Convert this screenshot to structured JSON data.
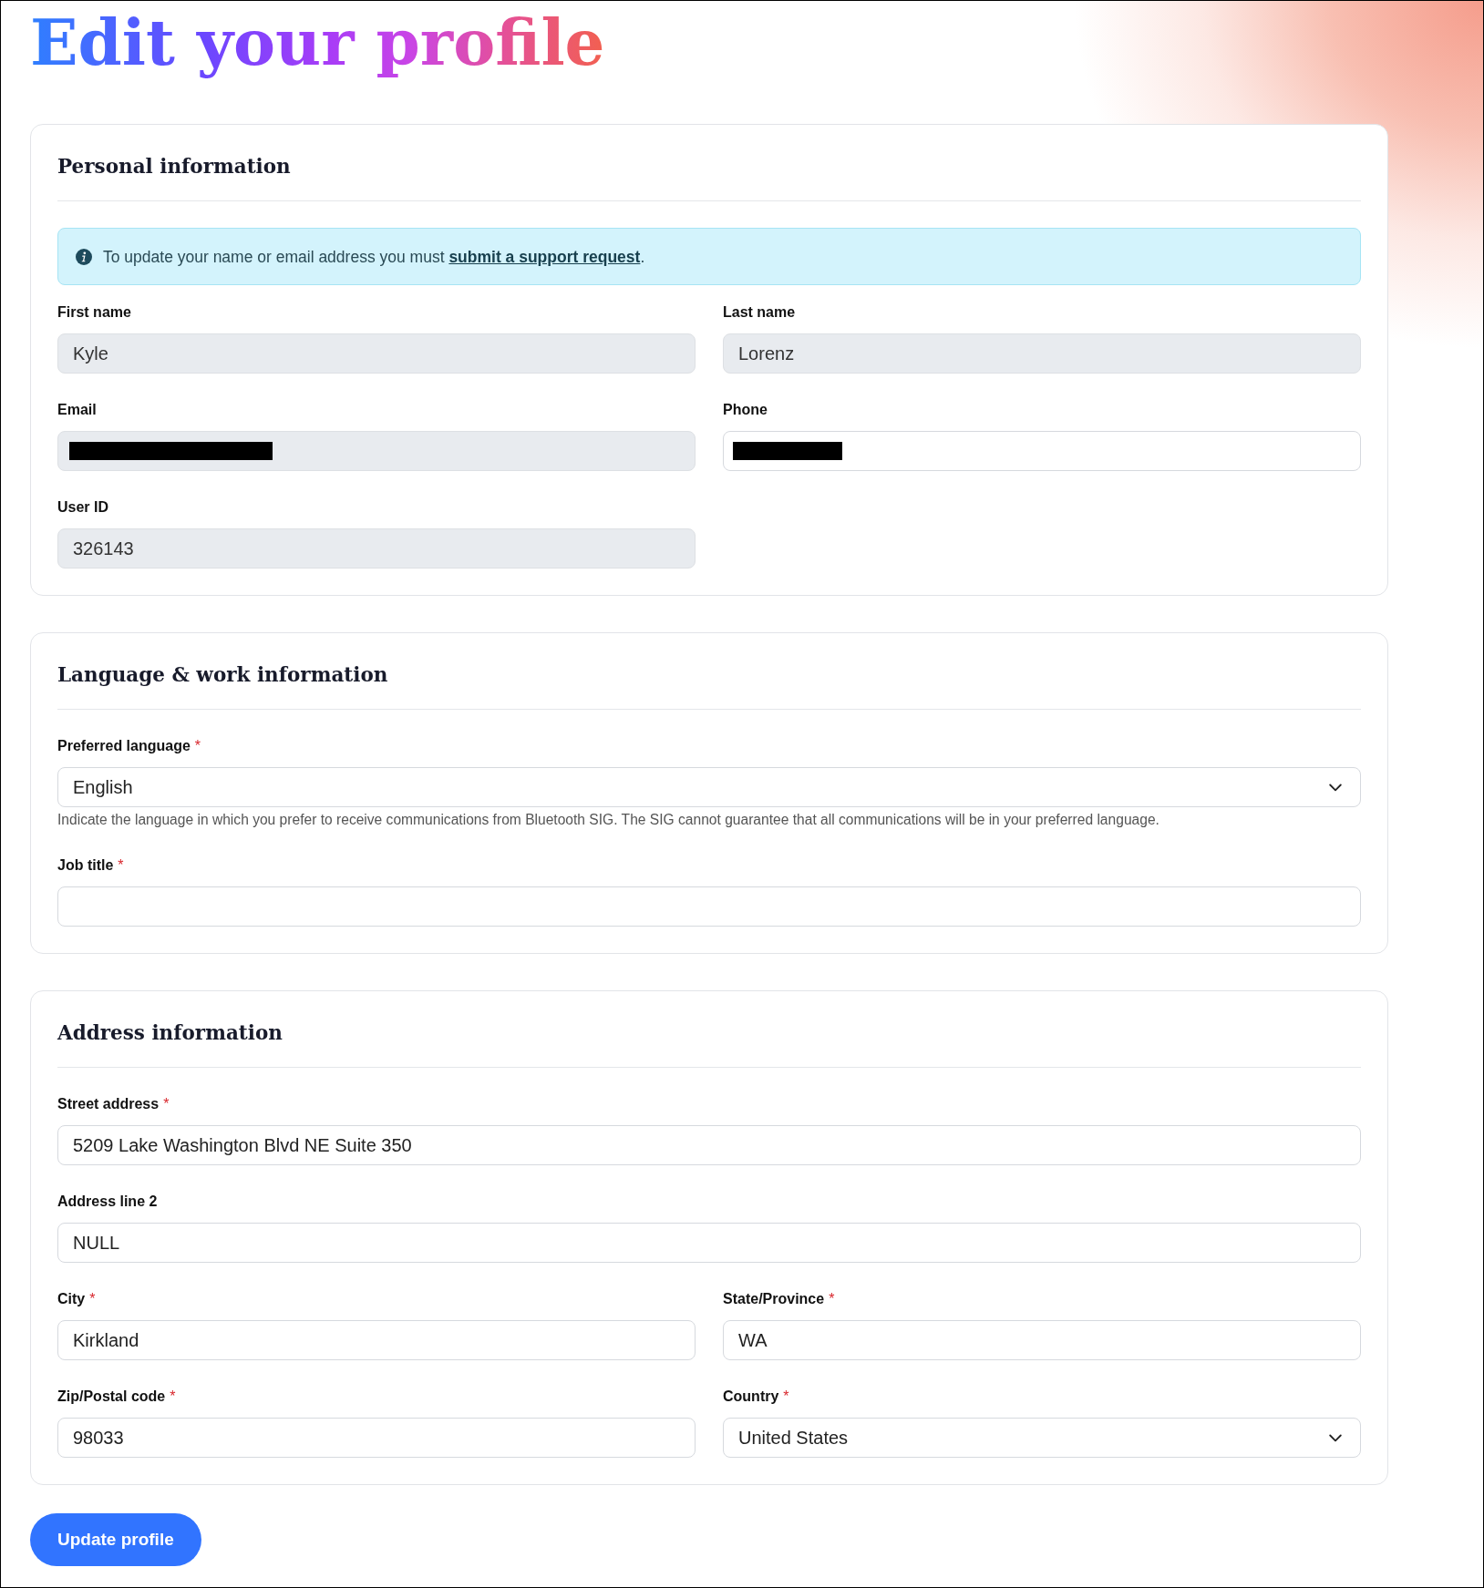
{
  "page": {
    "title": "Edit your profile"
  },
  "sections": [
    {
      "title": "Personal information",
      "notice": {
        "text": "To update your name or email address you must ",
        "link": "submit a support request",
        "text_after": "."
      },
      "fields": [
        {
          "label": "First name",
          "kind": "text",
          "value": "Kyle",
          "disabled": true,
          "redacted": false
        },
        {
          "label": "Last name",
          "kind": "text",
          "value": "Lorenz",
          "disabled": true,
          "redacted": false
        },
        {
          "label": "Email",
          "kind": "text",
          "disabled": true,
          "redacted": true
        },
        {
          "label": "Phone",
          "kind": "text",
          "disabled": false,
          "redacted": true
        },
        {
          "label": "User ID",
          "kind": "text",
          "value": "326143",
          "disabled": true,
          "redacted": false
        }
      ]
    },
    {
      "title": "Language & work information",
      "fields": [
        {
          "label": "Preferred language",
          "required_mark": "*",
          "kind": "select",
          "value": "English",
          "disabled": false,
          "redacted": false,
          "help": "Indicate the language in which you prefer to receive communications from Bluetooth SIG. The SIG cannot guarantee that all communications will be in your preferred language."
        },
        {
          "label": "Job title",
          "required_mark": "*",
          "kind": "text",
          "disabled": false,
          "redacted": false
        }
      ]
    },
    {
      "title": "Address information",
      "fields": [
        {
          "label": "Street address",
          "required_mark": "*",
          "kind": "text",
          "value": "5209 Lake Washington Blvd NE Suite 350",
          "disabled": false,
          "redacted": false
        },
        {
          "label": "Address line 2",
          "kind": "text",
          "value": "NULL",
          "disabled": false,
          "redacted": false
        },
        {
          "label": "City",
          "required_mark": "*",
          "kind": "text",
          "value": "Kirkland",
          "disabled": false,
          "redacted": false
        },
        {
          "label": "State/Province",
          "required_mark": "*",
          "kind": "text",
          "value": "WA",
          "disabled": false,
          "redacted": false
        },
        {
          "label": "Zip/Postal code",
          "required_mark": "*",
          "kind": "text",
          "value": "98033",
          "disabled": false,
          "redacted": false
        },
        {
          "label": "Country",
          "required_mark": "*",
          "kind": "select",
          "value": "United States",
          "disabled": false,
          "redacted": false
        }
      ]
    }
  ],
  "submit_button": "Update profile"
}
